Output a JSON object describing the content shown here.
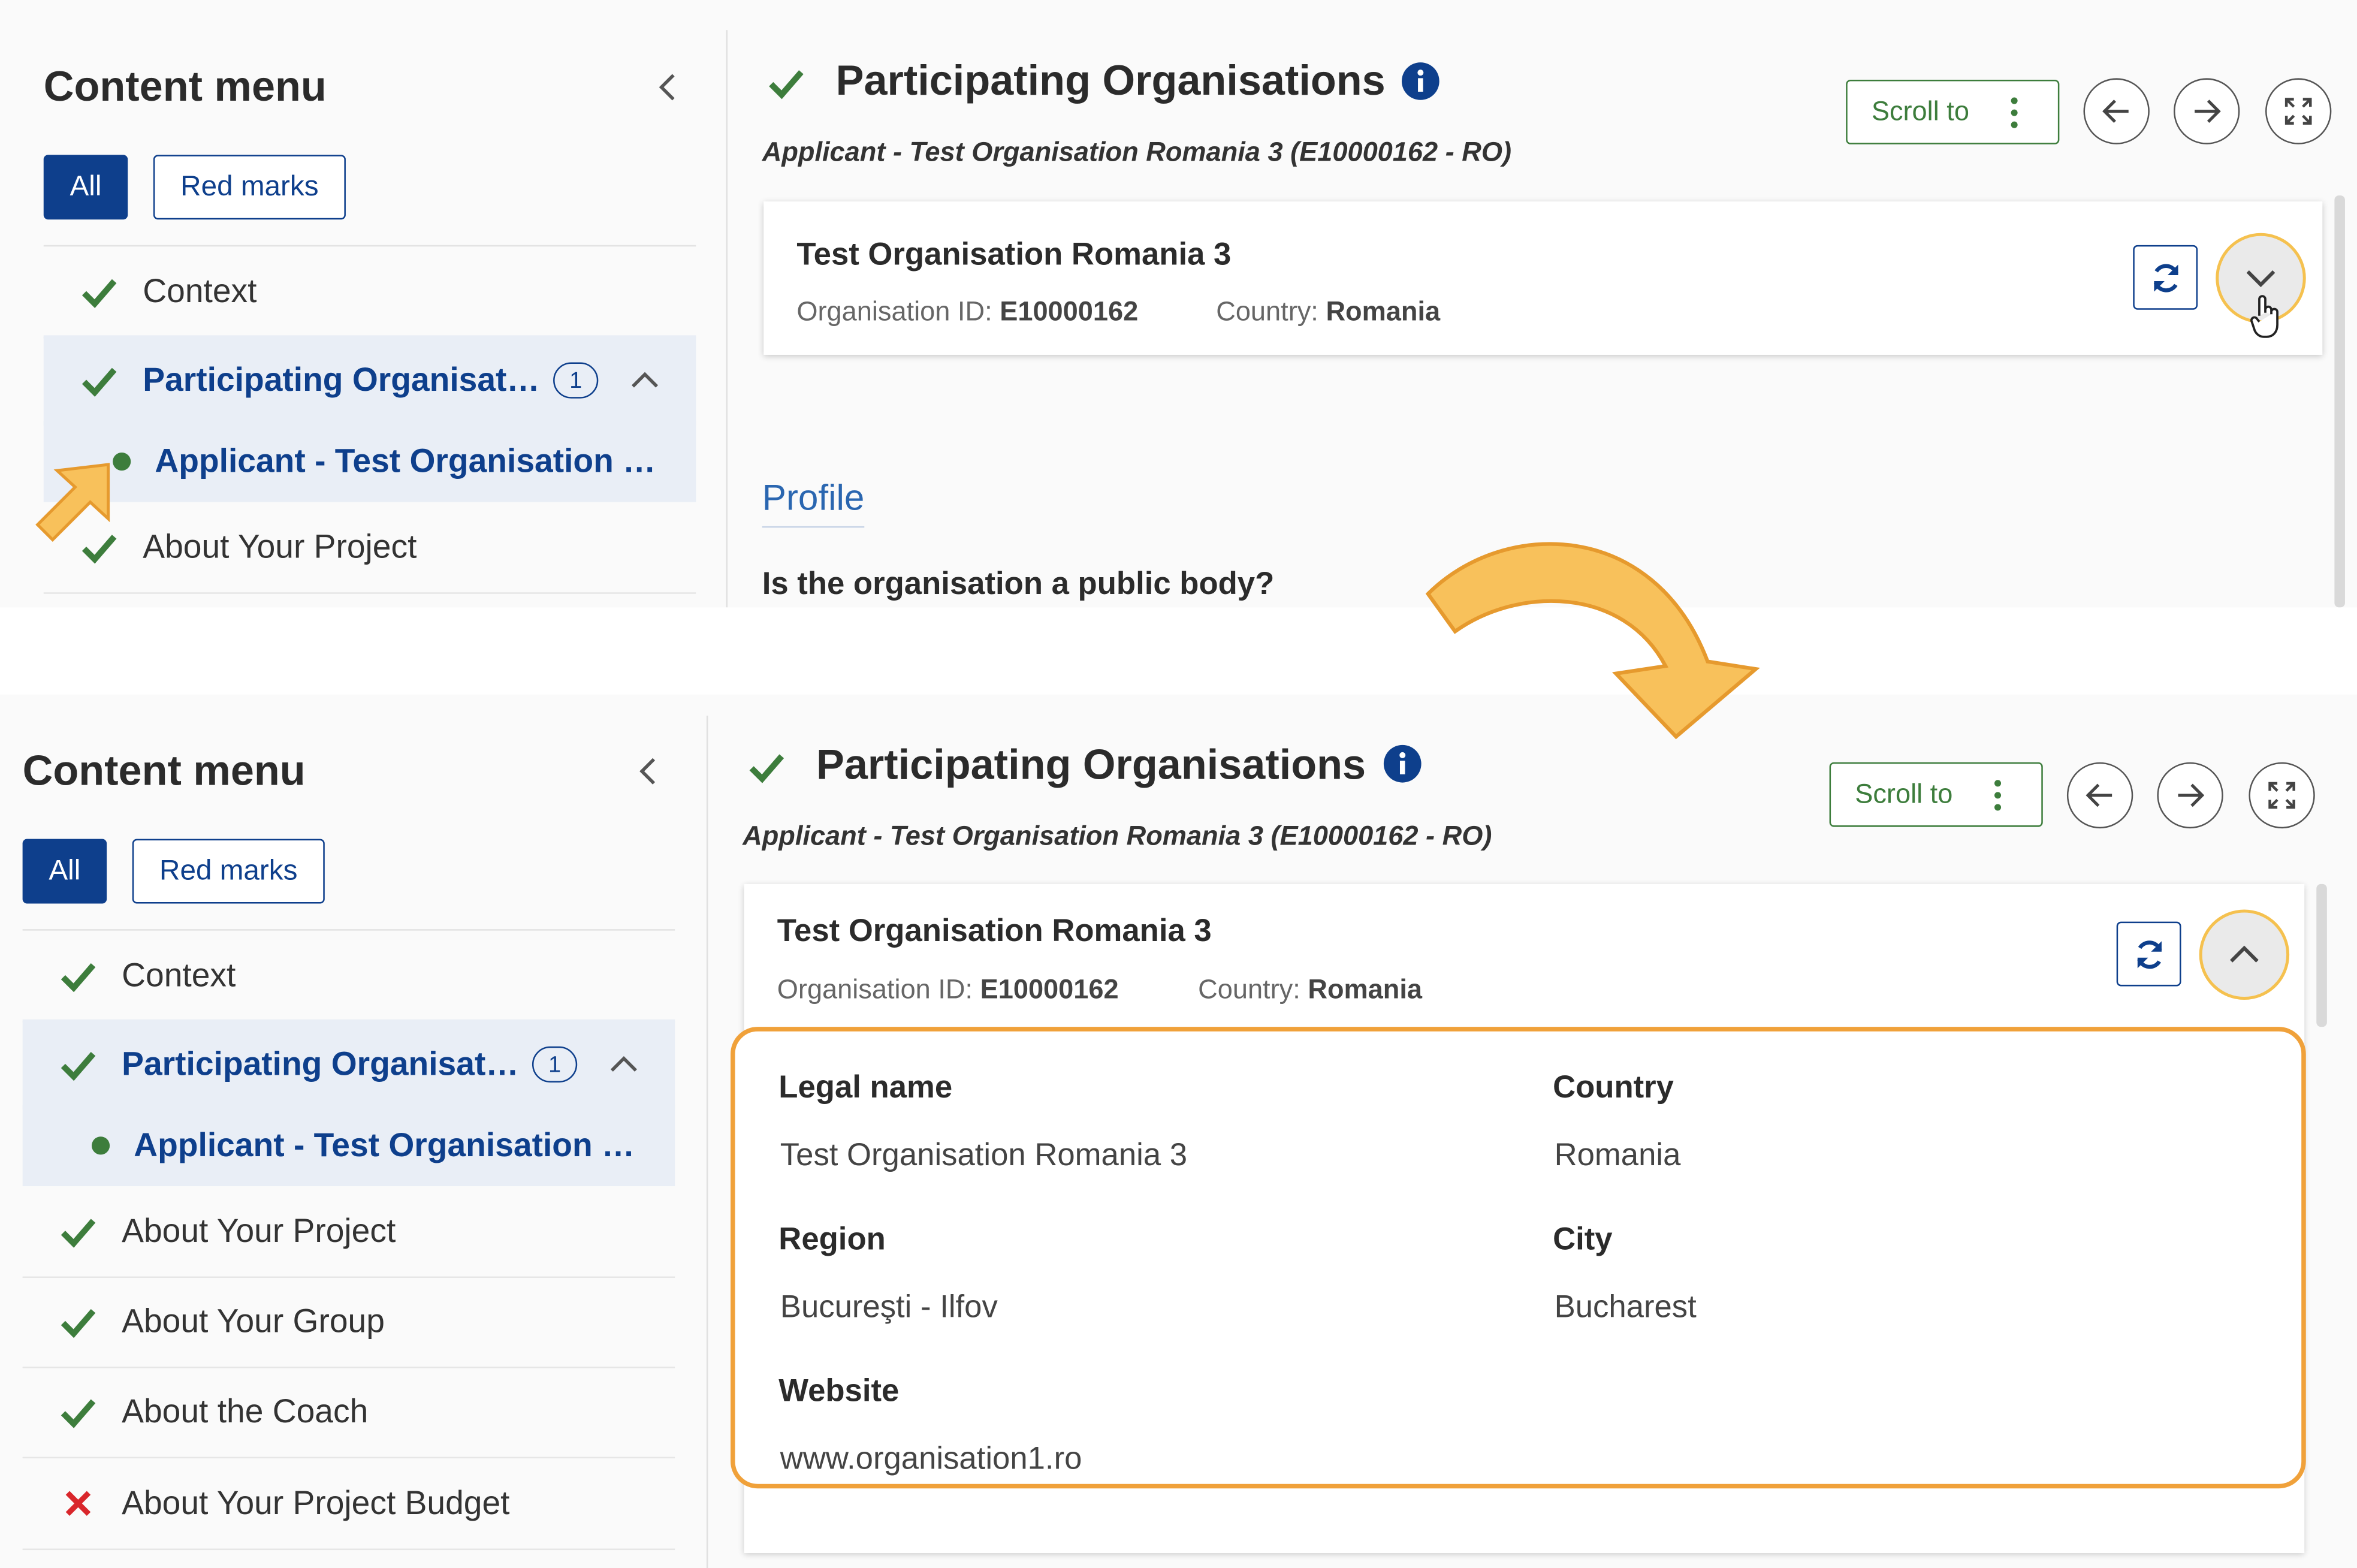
{
  "sidebar": {
    "title": "Content menu",
    "filter_all": "All",
    "filter_red": "Red marks",
    "items": [
      {
        "label": "Context",
        "status": "ok"
      },
      {
        "label": "Participating Organisat…",
        "status": "ok",
        "badge": "1"
      },
      {
        "label": "About Your Project",
        "status": "ok"
      },
      {
        "label": "About Your Group",
        "status": "ok"
      },
      {
        "label": "About the Coach",
        "status": "ok"
      },
      {
        "label": "About Your Project Budget",
        "status": "error"
      }
    ],
    "sub_item": "Applicant - Test Organisation …"
  },
  "header": {
    "title": "Participating Organisations",
    "subtitle": "Applicant - Test Organisation Romania 3 (E10000162 - RO)",
    "scroll_to": "Scroll to"
  },
  "org": {
    "name": "Test Organisation Romania 3",
    "id_label": "Organisation ID:",
    "id_value": "E10000162",
    "country_label": "Country:",
    "country_value": "Romania"
  },
  "profile": {
    "link": "Profile",
    "question": "Is the organisation a public body?"
  },
  "details": {
    "legal_name_label": "Legal name",
    "legal_name": "Test Organisation Romania 3",
    "country_label": "Country",
    "country": "Romania",
    "region_label": "Region",
    "region": "Bucureşti - Ilfov",
    "city_label": "City",
    "city": "Bucharest",
    "website_label": "Website",
    "website": "www.organisation1.ro"
  },
  "colors": {
    "primary": "#0e3f8c",
    "success": "#3d7d3c",
    "error": "#d9262b",
    "highlight": "#f0a13a"
  }
}
